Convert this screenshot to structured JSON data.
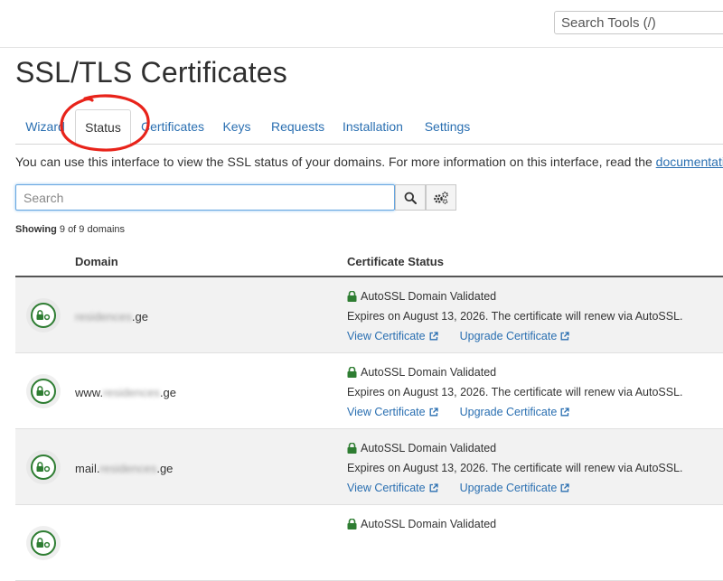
{
  "search_tools": {
    "placeholder": "Search Tools (/)"
  },
  "page_title": "SSL/TLS Certificates",
  "tabs": [
    {
      "label": "Wizard"
    },
    {
      "label": "Status"
    },
    {
      "label": "Certificates"
    },
    {
      "label": "Keys"
    },
    {
      "label": "Requests"
    },
    {
      "label": "Installation"
    },
    {
      "label": "Settings"
    }
  ],
  "intro": {
    "text": "You can use this interface to view the SSL status of your domains. For more information on this interface, read the ",
    "link": "documentation",
    "end": "."
  },
  "domain_search": {
    "placeholder": "Search"
  },
  "showing": {
    "label": "Showing",
    "text": "9 of 9 domains"
  },
  "table": {
    "headers": {
      "domain": "Domain",
      "status": "Certificate Status"
    },
    "rows": [
      {
        "prefix": "",
        "blurred": "residences",
        "suffix": ".ge",
        "status": "AutoSSL Domain Validated",
        "expires": "Expires on August 13, 2026. The certificate will renew via AutoSSL.",
        "view": "View Certificate",
        "upgrade": "Upgrade Certificate"
      },
      {
        "prefix": "www.",
        "blurred": "residences",
        "suffix": ".ge",
        "status": "AutoSSL Domain Validated",
        "expires": "Expires on August 13, 2026. The certificate will renew via AutoSSL.",
        "view": "View Certificate",
        "upgrade": "Upgrade Certificate"
      },
      {
        "prefix": "mail.",
        "blurred": "residences",
        "suffix": ".ge",
        "status": "AutoSSL Domain Validated",
        "expires": "Expires on August 13, 2026. The certificate will renew via AutoSSL.",
        "view": "View Certificate",
        "upgrade": "Upgrade Certificate"
      },
      {
        "prefix": "",
        "blurred": "",
        "suffix": "",
        "status": "AutoSSL Domain Validated",
        "expires": "",
        "view": "",
        "upgrade": ""
      }
    ]
  },
  "colors": {
    "link": "#2a6fb1",
    "valid_green": "#2e7d32",
    "annotation": "#e8231a"
  },
  "icons": [
    "search-icon",
    "settings-gears-icon",
    "lock-icon",
    "external-link-icon",
    "ssl-status-icon"
  ]
}
